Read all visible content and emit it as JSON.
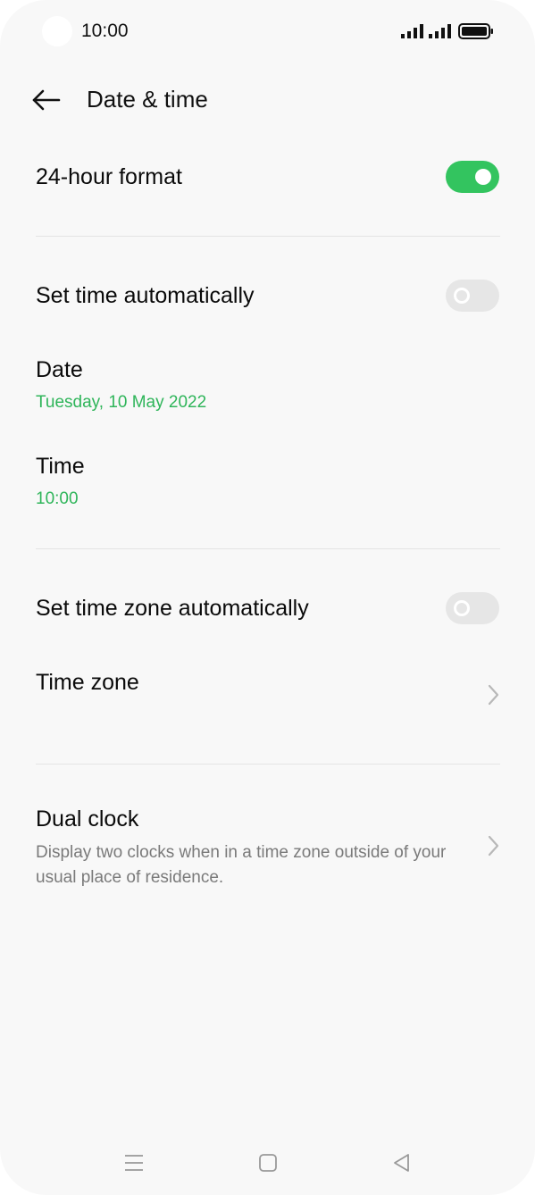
{
  "status_bar": {
    "time": "10:00",
    "icons": [
      "signal-icon",
      "signal-icon",
      "battery-icon"
    ]
  },
  "header": {
    "title": "Date & time",
    "back_icon": "arrow-left-icon"
  },
  "settings": {
    "hour_format": {
      "label": "24-hour format",
      "enabled": true
    },
    "set_time_auto": {
      "label": "Set time automatically",
      "enabled": false
    },
    "date": {
      "label": "Date",
      "value": "Tuesday, 10 May 2022"
    },
    "time": {
      "label": "Time",
      "value": "10:00"
    },
    "set_timezone_auto": {
      "label": "Set time zone automatically",
      "enabled": false
    },
    "time_zone": {
      "label": "Time zone"
    },
    "dual_clock": {
      "label": "Dual clock",
      "description": "Display two clocks when in a time zone outside of your usual place of residence."
    }
  },
  "nav_bar": {
    "icons": [
      "menu-icon",
      "home-icon",
      "back-triangle-icon"
    ]
  },
  "colors": {
    "accent": "#33c45f",
    "accent_text": "#2fb55a",
    "background": "#f8f8f8"
  }
}
